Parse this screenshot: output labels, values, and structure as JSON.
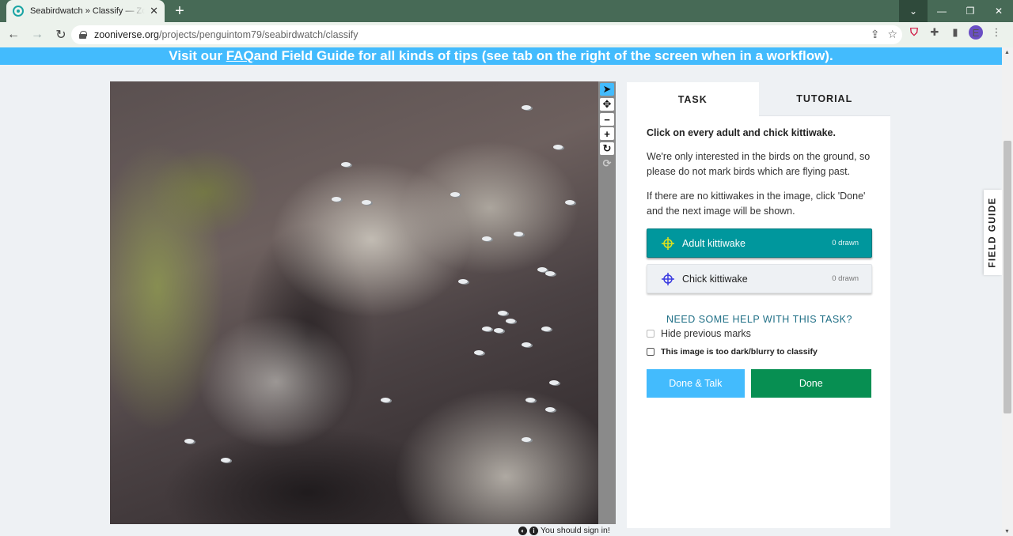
{
  "browser": {
    "tab_title": "Seabirdwatch » Classify — Zooniverse",
    "tab_close": "✕",
    "new_tab": "+",
    "url_host": "zooniverse.org",
    "url_path": "/projects/penguintom79/seabirdwatch/classify",
    "profile_initial": "E"
  },
  "banner": {
    "prefix": "Visit our ",
    "faq_link": "FAQ",
    "suffix": " and Field Guide for all kinds of tips (see tab on the right of the screen when in a workflow)."
  },
  "task_panel": {
    "tabs": {
      "task": "TASK",
      "tutorial": "TUTORIAL"
    },
    "question": "Click on every adult and chick kittiwake.",
    "paragraphs": [
      "We're only interested in the birds on the ground, so please do not mark birds which are flying past.",
      "If there are no kittiwakes in the image, click 'Done' and the next image will be shown."
    ],
    "answers": [
      {
        "label": "Adult kittiwake",
        "count": "0 drawn",
        "color": "#e3e21b"
      },
      {
        "label": "Chick kittiwake",
        "count": "0 drawn",
        "color": "#3a3ae0"
      }
    ],
    "help": "NEED SOME HELP WITH THIS TASK?",
    "hide_marks": "Hide previous marks",
    "too_dark": "This image is too dark/blurry to classify",
    "done_talk": "Done & Talk",
    "done": "Done"
  },
  "viewer": {
    "sign_in": "You should sign in!"
  },
  "field_guide": "FIELD GUIDE",
  "colors": {
    "accent_blue": "#43bbfd",
    "teal": "#00979d",
    "done_green": "#078f52"
  }
}
